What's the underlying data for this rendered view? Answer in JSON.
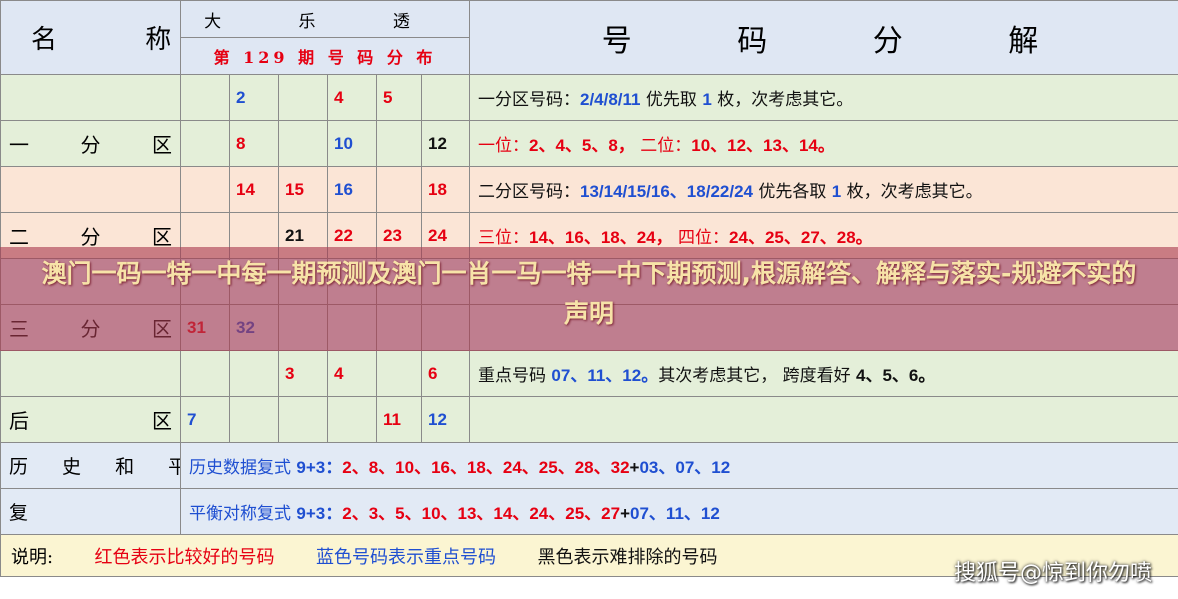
{
  "header": {
    "name_label": "名 称",
    "lotto_name": "大 乐 透",
    "period": "第 129 期 号 码 分 布",
    "decomposition_label": "号 码 分 解"
  },
  "zones": [
    {
      "label": "一 分 区",
      "rows": [
        [
          {
            "t": "",
            "c": ""
          },
          {
            "t": "2",
            "c": "blue"
          },
          {
            "t": "",
            "c": ""
          },
          {
            "t": "4",
            "c": "red"
          },
          {
            "t": "5",
            "c": "red"
          },
          {
            "t": "",
            "c": ""
          }
        ],
        [
          {
            "t": "",
            "c": ""
          },
          {
            "t": "8",
            "c": "red"
          },
          {
            "t": "",
            "c": ""
          },
          {
            "t": "10",
            "c": "blue"
          },
          {
            "t": "",
            "c": ""
          },
          {
            "t": "12",
            "c": "black"
          }
        ]
      ],
      "desc1": [
        {
          "t": "一分区号码：",
          "c": "black"
        },
        {
          "t": "2/4/8/11",
          "c": "blue",
          "n": true
        },
        {
          "t": " 优先取 ",
          "c": "black"
        },
        {
          "t": "1",
          "c": "blue",
          "n": true
        },
        {
          "t": " 枚，次考虑其它。",
          "c": "black"
        }
      ],
      "desc2": [
        {
          "t": "一位：",
          "c": "red"
        },
        {
          "t": "2、4、5、8，",
          "c": "red",
          "n": true
        },
        {
          "t": "      二位：",
          "c": "red"
        },
        {
          "t": "10、12、13、14。",
          "c": "red",
          "n": true
        }
      ],
      "bg": "#e4efd9"
    },
    {
      "label": "二 分 区",
      "rows": [
        [
          {
            "t": "",
            "c": ""
          },
          {
            "t": "14",
            "c": "red"
          },
          {
            "t": "15",
            "c": "red"
          },
          {
            "t": "16",
            "c": "blue"
          },
          {
            "t": "",
            "c": ""
          },
          {
            "t": "18",
            "c": "red"
          }
        ],
        [
          {
            "t": "",
            "c": ""
          },
          {
            "t": "",
            "c": ""
          },
          {
            "t": "21",
            "c": "black"
          },
          {
            "t": "22",
            "c": "red"
          },
          {
            "t": "23",
            "c": "red"
          },
          {
            "t": "24",
            "c": "red"
          }
        ]
      ],
      "desc1": [
        {
          "t": "二分区号码：",
          "c": "black"
        },
        {
          "t": "13/14/15/16、18/22/24",
          "c": "blue",
          "n": true
        },
        {
          "t": " 优先各取 ",
          "c": "black"
        },
        {
          "t": "1",
          "c": "blue",
          "n": true
        },
        {
          "t": " 枚，次考虑其它。",
          "c": "black"
        }
      ],
      "desc2": [
        {
          "t": "三位：",
          "c": "red"
        },
        {
          "t": "14、16、18、24，",
          "c": "red",
          "n": true
        },
        {
          "t": "   四位：",
          "c": "red"
        },
        {
          "t": "24、25、27、28。",
          "c": "red",
          "n": true
        }
      ],
      "bg": "#fbe5d6"
    },
    {
      "label": "三 分 区",
      "rows": [
        [
          {
            "t": "",
            "c": ""
          },
          {
            "t": "",
            "c": ""
          },
          {
            "t": "",
            "c": ""
          },
          {
            "t": "",
            "c": ""
          },
          {
            "t": "",
            "c": ""
          },
          {
            "t": "",
            "c": ""
          }
        ],
        [
          {
            "t": "31",
            "c": "red"
          },
          {
            "t": "32",
            "c": "blue"
          },
          {
            "t": "",
            "c": ""
          },
          {
            "t": "",
            "c": ""
          },
          {
            "t": "",
            "c": ""
          },
          {
            "t": "",
            "c": ""
          }
        ]
      ],
      "desc1": [],
      "desc2": [],
      "bg": "#e2eaf5"
    },
    {
      "label": "后 区",
      "rows": [
        [
          {
            "t": "",
            "c": ""
          },
          {
            "t": "",
            "c": ""
          },
          {
            "t": "3",
            "c": "red"
          },
          {
            "t": "4",
            "c": "red"
          },
          {
            "t": "",
            "c": ""
          },
          {
            "t": "6",
            "c": "red"
          }
        ],
        [
          {
            "t": "7",
            "c": "blue"
          },
          {
            "t": "",
            "c": ""
          },
          {
            "t": "",
            "c": ""
          },
          {
            "t": "",
            "c": ""
          },
          {
            "t": "11",
            "c": "red"
          },
          {
            "t": "12",
            "c": "blue"
          }
        ]
      ],
      "desc1": [
        {
          "t": "重点号码 ",
          "c": "black"
        },
        {
          "t": "07、11、12。",
          "c": "blue",
          "n": true
        },
        {
          "t": "其次考虑其它，  跨度看好 ",
          "c": "black"
        },
        {
          "t": "4、5、6。",
          "c": "black",
          "n": true
        }
      ],
      "desc2": [],
      "bg": "#e4efd9"
    }
  ],
  "history": {
    "label_line1": "历 史 和 平 衡",
    "label_line2": "复 式",
    "row1": [
      {
        "t": "历史数据复式 ",
        "c": "blue"
      },
      {
        "t": "9+3：",
        "c": "blue",
        "n": true
      },
      {
        "t": "2、8、10、16、18、24、25、28、32",
        "c": "red",
        "n": true
      },
      {
        "t": "+",
        "c": "black",
        "n": true
      },
      {
        "t": "03、07、12",
        "c": "blue",
        "n": true
      }
    ],
    "row2": [
      {
        "t": "平衡对称复式 ",
        "c": "blue"
      },
      {
        "t": "9+3：",
        "c": "blue",
        "n": true
      },
      {
        "t": "2、3、5、10、13、14、24、25、27",
        "c": "red",
        "n": true
      },
      {
        "t": "+",
        "c": "black",
        "n": true
      },
      {
        "t": "07、11、12",
        "c": "blue",
        "n": true
      }
    ]
  },
  "legend": {
    "title": "说明:",
    "red_note": "红色表示比较好的号码",
    "blue_note": "蓝色号码表示重点号码",
    "black_note": "黑色表示难排除的号码"
  },
  "overlay_title": "澳门一码一特一中每一期预测及澳门一肖一马一特一中下期预测,根源解答、解释与落实-规避不实的声明",
  "watermark": "搜狐号@惊到你勿喷",
  "colors": {
    "red": "#e60012",
    "blue": "#1f4fd1",
    "green_bg": "#e4efd9",
    "peach_bg": "#fbe5d6",
    "blue_bg": "#e2eaf5",
    "overlay": "#aa3c50"
  }
}
